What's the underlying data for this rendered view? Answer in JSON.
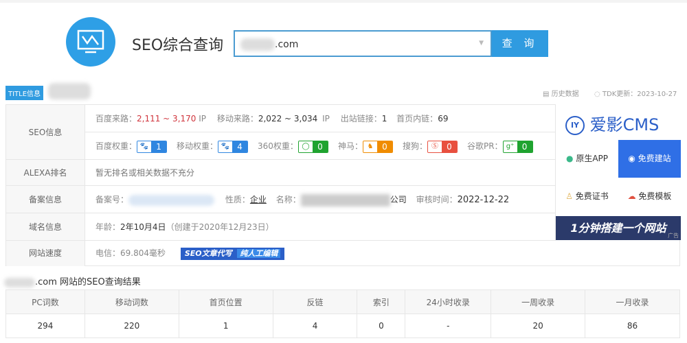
{
  "header": {
    "title": "SEO综合查询",
    "search_value": ".com",
    "query_button": "查 询"
  },
  "title_tag": "TITLE信息",
  "toolbar": {
    "history": "历史数据",
    "tdk": "TDK更新：2023-10-27"
  },
  "seo": {
    "label": "SEO信息",
    "baidu_traffic_label": "百度来路：",
    "baidu_traffic": "2,111 ~ 3,170",
    "ip1": "IP",
    "mobile_traffic_label": "移动来路：",
    "mobile_traffic": "2,022 ~ 3,034",
    "ip2": "IP",
    "outlinks_label": "出站链接：",
    "outlinks": "1",
    "inlinks_label": "首页内链：",
    "inlinks": "69",
    "weights": [
      {
        "label": "百度权重：",
        "value": "1",
        "color": "#2f86e0",
        "icon": "paw-icon"
      },
      {
        "label": "移动权重：",
        "value": "4",
        "color": "#2f86e0",
        "icon": "paw-icon"
      },
      {
        "label": "360权重：",
        "value": "0",
        "color": "#1fa32f",
        "icon": "360-icon"
      },
      {
        "label": "神马：",
        "value": "0",
        "color": "#f08c00",
        "icon": "shenma-icon"
      },
      {
        "label": "搜狗：",
        "value": "0",
        "color": "#e8503f",
        "icon": "sogou-icon"
      },
      {
        "label": "谷歌PR：",
        "value": "0",
        "color": "#1fa32f",
        "icon": "google-icon"
      }
    ]
  },
  "alexa": {
    "label": "ALEXA排名",
    "text": "暂无排名或相关数据不充分"
  },
  "beian": {
    "label": "备案信息",
    "num_label": "备案号：",
    "nature_label": "性质：",
    "nature": "企业",
    "name_label": "名称：",
    "name_suffix": "公司",
    "audit_label": "审核时间：",
    "audit": "2022-12-22"
  },
  "domain": {
    "label": "域名信息",
    "age_label": "年龄：",
    "age": "2年10月4日",
    "created": "（创建于2020年12月23日）"
  },
  "speed": {
    "label": "网站速度",
    "text": "电信：69.804毫秒",
    "promo1": "SEO文章代写",
    "promo2": "纯人工编辑"
  },
  "ad": {
    "brand": "爱影CMS",
    "app": "原生APP",
    "free_site": "免费建站",
    "cert": "免费证书",
    "template": "免费模板",
    "banner": "1分钟搭建一个网站",
    "tag": "广告"
  },
  "results": {
    "title": ".com 网站的SEO查询结果",
    "headers": [
      "PC词数",
      "移动词数",
      "首页位置",
      "反链",
      "索引",
      "24小时收录",
      "一周收录",
      "一月收录"
    ],
    "values": [
      "294",
      "220",
      "1",
      "4",
      "0",
      "-",
      "20",
      "86"
    ]
  }
}
